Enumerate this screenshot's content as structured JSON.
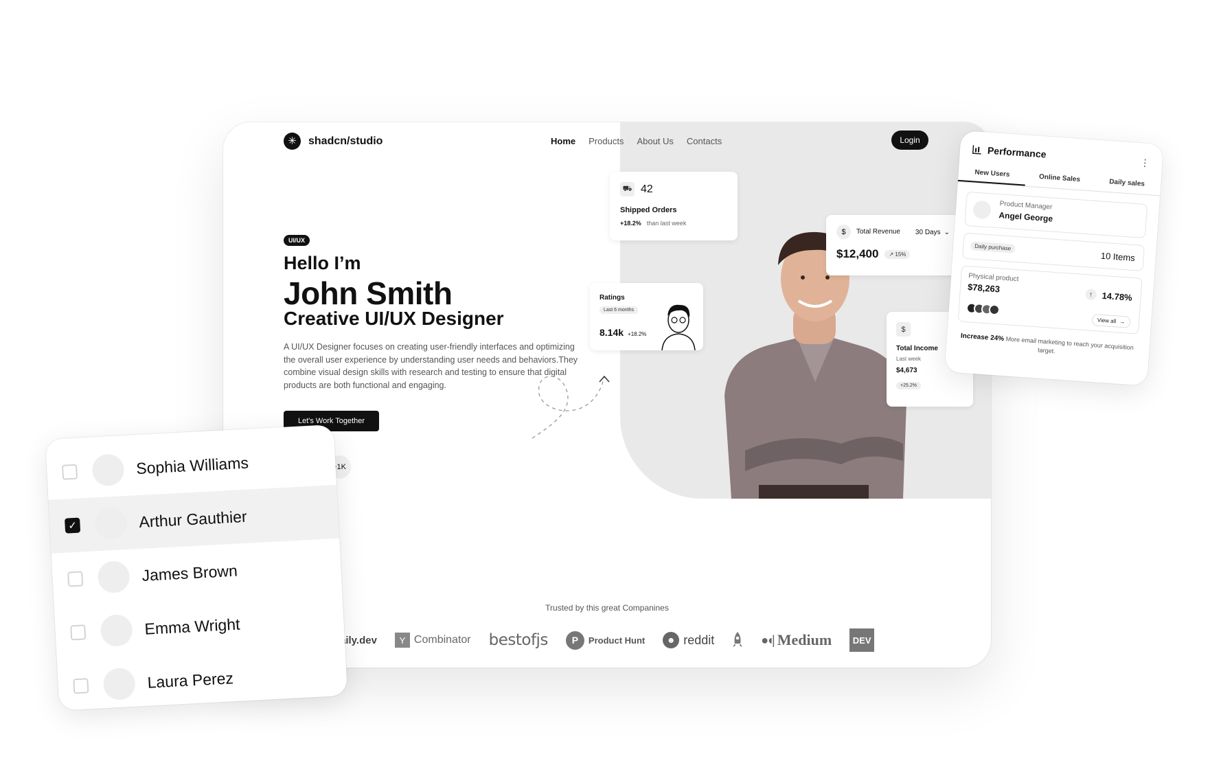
{
  "site": {
    "logo_icon": "asterisk-icon",
    "name": "shadcn/studio",
    "nav": [
      "Home",
      "Products",
      "About Us",
      "Contacts"
    ],
    "login": "Login"
  },
  "hero": {
    "badge": "UI/UX",
    "hello": "Hello I’m",
    "name": "John Smith",
    "role": "Creative UI/UX Designer",
    "description": "A UI/UX Designer focuses on creating user-friendly interfaces and optimizing the overall user experience by understanding user needs and behaviors.They combine visual design skills with research and testing to ensure that digital products are both functional and engaging.",
    "cta": "Let's Work Together",
    "followers": "+1K"
  },
  "cards": {
    "shipped": {
      "icon": "truck-icon",
      "value": "42",
      "label": "Shipped Orders",
      "change": "+18.2%",
      "period": "than last week"
    },
    "revenue": {
      "icon": "dollar-icon",
      "label": "Total Revenue",
      "range": "30 Days",
      "value": "$12,400",
      "change": "15%"
    },
    "ratings": {
      "label": "Ratings",
      "period": "Last 6 months",
      "value": "8.14k",
      "change": "+18.2%"
    },
    "income": {
      "icon": "dollar-circle-icon",
      "label": "Total Income",
      "period": "Last week",
      "value": "$4,673",
      "change": "+25.2%"
    }
  },
  "trusted": {
    "title": "Trusted by this great Companines",
    "logos": [
      "aily.dev",
      "Combinator",
      "bestofjs",
      "Product Hunt",
      "reddit",
      "Medium",
      "DEV"
    ]
  },
  "performance": {
    "title": "Performance",
    "tabs": [
      "New Users",
      "Online Sales",
      "Daily sales"
    ],
    "active_tab": "New Users",
    "manager_role": "Product Manager",
    "manager_name": "Angel George",
    "daily_purchase_label": "Daily purchase",
    "daily_purchase_value": "10 Items",
    "physical_label": "Physical product",
    "physical_value": "$78,263",
    "physical_change": "14.78%",
    "view_all": "View all",
    "footer_bold": "Increase 24%",
    "footer_text": "More email marketing to reach your acquisition target."
  },
  "users": {
    "list": [
      {
        "name": "Sophia Williams",
        "checked": false
      },
      {
        "name": "Arthur Gauthier",
        "checked": true
      },
      {
        "name": "James Brown",
        "checked": false
      },
      {
        "name": "Emma Wright",
        "checked": false
      },
      {
        "name": "Laura Perez",
        "checked": false
      }
    ]
  }
}
